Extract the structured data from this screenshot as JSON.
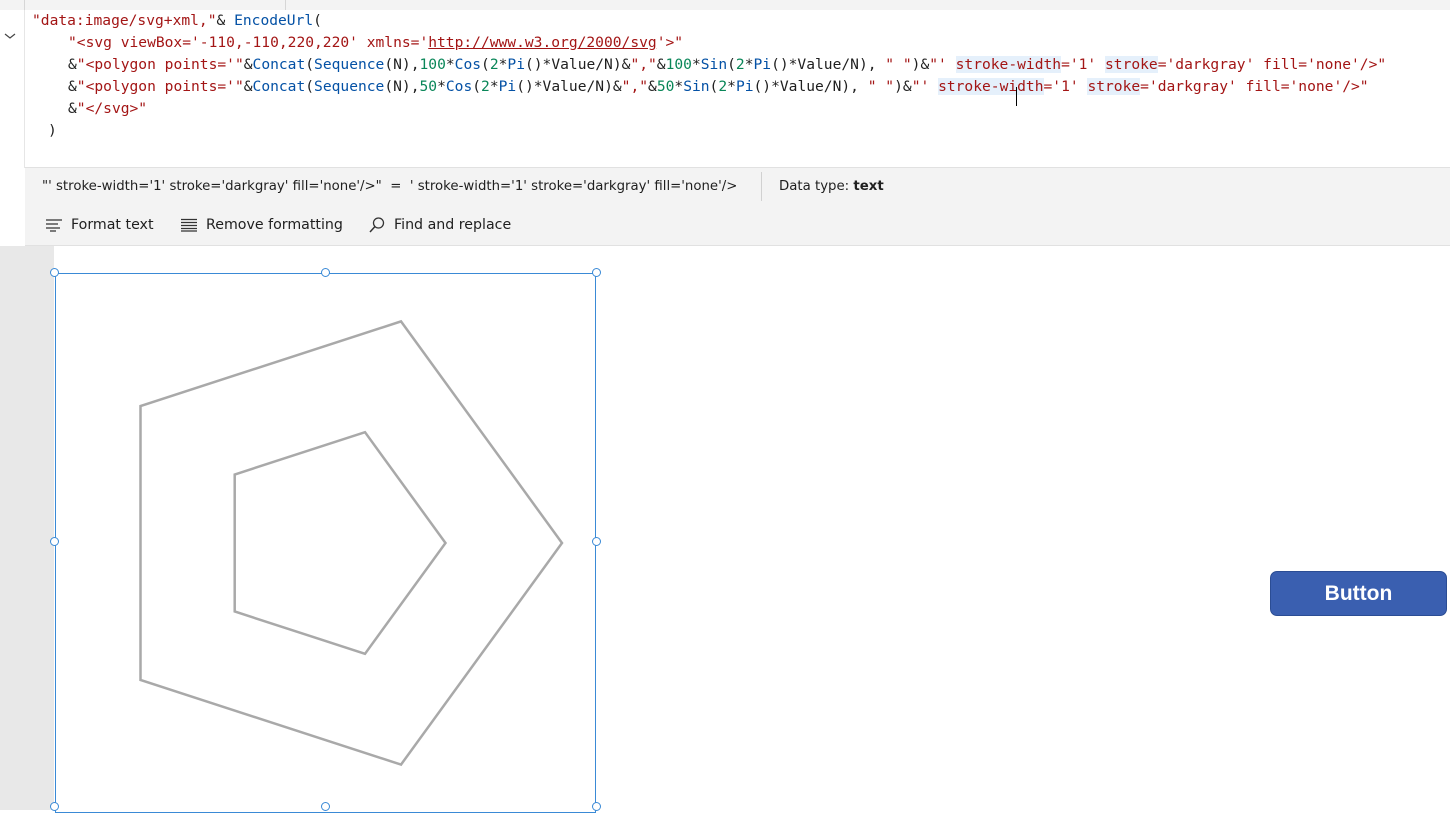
{
  "formula": {
    "line1": {
      "s1": "\"data:image/svg+xml,\"",
      "op1": "& ",
      "fn": "EncodeUrl",
      "paren": "("
    },
    "line2": {
      "s1": "\"<svg viewBox='-110,-110,220,220' xmlns='",
      "url": "http://www.w3.org/2000/svg",
      "s2": "'>\""
    },
    "line3": {
      "op": "&",
      "s1": "\"<polygon points='\"",
      "op2": "&",
      "concat": "Concat",
      "p1": "(",
      "seq": "Sequence",
      "p2": "(N),",
      "n100a": "100",
      "mul1": "*",
      "cos": "Cos",
      "p3": "(",
      "two1": "2",
      "mul2": "*",
      "pi1": "Pi",
      "p4": "()*Value/N)",
      "op3": "&",
      "comma": "\",\"",
      "op4": "&",
      "n100b": "100",
      "mul3": "*",
      "sin": "Sin",
      "p5": "(",
      "two2": "2",
      "mul4": "*",
      "pi2": "Pi",
      "p6": "()*Value/N),",
      "space": " \" \"",
      "p7": ")",
      "op5": "&",
      "tail_a": "\"' ",
      "sw": "stroke-width",
      "tail_b": "='1' ",
      "st": "stroke",
      "tail_c": "='darkgray' fill='none'/>\""
    },
    "line4": {
      "op": "&",
      "s1": "\"<polygon points='\"",
      "op2": "&",
      "concat": "Concat",
      "p1": "(",
      "seq": "Sequence",
      "p2": "(N),",
      "n50a": "50",
      "mul1": "*",
      "cos": "Cos",
      "p3": "(",
      "two1": "2",
      "mul2": "*",
      "pi1": "Pi",
      "p4": "()*Value/N)",
      "op3": "&",
      "comma": "\",\"",
      "op4": "&",
      "n50b": "50",
      "mul3": "*",
      "sin": "Sin",
      "p5": "(",
      "two2": "2",
      "mul4": "*",
      "pi2": "Pi",
      "p6": "()*Value/N),",
      "space": " \" \"",
      "p7": ")",
      "op5": "&",
      "tail_a": "\"' ",
      "sw": "stroke-width",
      "tail_b": "='1' ",
      "st": "stroke",
      "tail_c": "='darkgray' fill='none'/>\""
    },
    "line5": {
      "op": "&",
      "s1": "\"</svg>\""
    },
    "line6": ")"
  },
  "eval": {
    "expression": "\"' stroke-width='1' stroke='darkgray' fill='none'/>\"  =  ' stroke-width='1' stroke='darkgray' fill='none'/>",
    "type_label": "Data type: ",
    "type_value": "text"
  },
  "toolbar": {
    "format_text": "Format text",
    "remove_formatting": "Remove formatting",
    "find_replace": "Find and replace"
  },
  "canvas": {
    "button_label": "Button"
  },
  "svg_figure": {
    "stroke_color": "#a9a9a9",
    "polygons": [
      {
        "radius": 100,
        "sides": 5
      },
      {
        "radius": 50,
        "sides": 5
      }
    ]
  },
  "colors": {
    "button_bg": "#3a5fb0",
    "selection": "#3a8ad6"
  }
}
